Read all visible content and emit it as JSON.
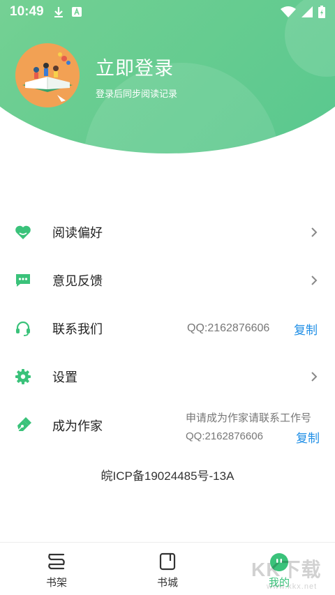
{
  "status_bar": {
    "time": "10:49"
  },
  "colors": {
    "brand_green": "#5cc98f",
    "link_blue": "#1e8ee6",
    "icon_green": "#3ac27a"
  },
  "profile": {
    "title": "立即登录",
    "subtitle": "登录后同步阅读记录"
  },
  "menu": {
    "items": [
      {
        "label": "阅读偏好",
        "icon": "heart-icon"
      },
      {
        "label": "意见反馈",
        "icon": "message-icon"
      },
      {
        "label": "联系我们",
        "icon": "headset-icon",
        "value": "QQ:2162876606",
        "action": "复制"
      },
      {
        "label": "设置",
        "icon": "gear-icon"
      },
      {
        "label": "成为作家",
        "icon": "pen-icon",
        "note_line1": "申请成为作家请联系工作号",
        "note_line2": "QQ:2162876606",
        "action": "复制"
      }
    ]
  },
  "icp": "皖ICP备19024485号-13A",
  "bottom_nav": {
    "items": [
      {
        "label": "书架",
        "icon": "bookshelf-icon",
        "active": false
      },
      {
        "label": "书城",
        "icon": "bookstore-icon",
        "active": false
      },
      {
        "label": "我的",
        "icon": "mine-icon",
        "active": true
      }
    ]
  },
  "watermark": {
    "big": "KK下载",
    "small": "www.kkx.net"
  }
}
